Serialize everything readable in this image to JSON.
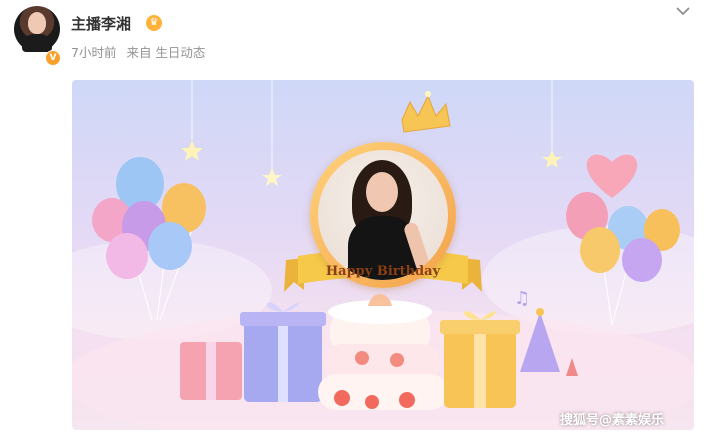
{
  "post": {
    "username": "主播李湘",
    "time": "7小时前",
    "source": "来自 生日动态",
    "verified_badge": "V"
  },
  "image": {
    "banner_text": "Happy Birthday",
    "watermark": "搜狐号@素素娱乐"
  },
  "icons": {
    "menu": "chevron-down-icon",
    "vip": "crown-icon",
    "verified": "verified-icon"
  },
  "colors": {
    "username": "#333333",
    "meta": "#939393",
    "verified": "#f7a12b",
    "banner": "#f6c94a"
  }
}
